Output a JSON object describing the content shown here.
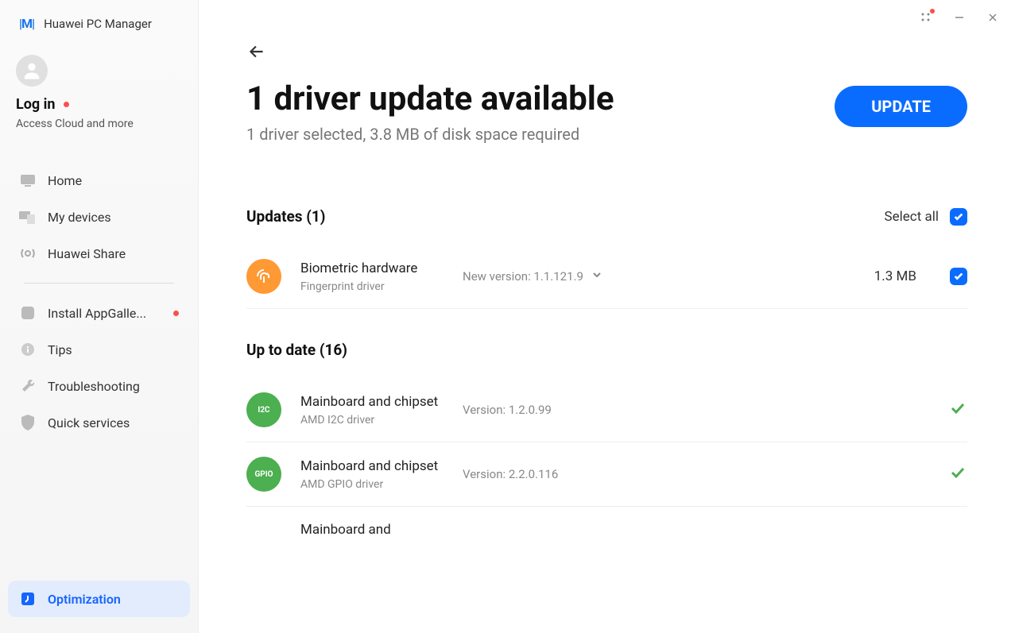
{
  "app": {
    "title": "Huawei PC Manager",
    "login_label": "Log in",
    "login_sub": "Access Cloud and more"
  },
  "nav": {
    "home": "Home",
    "my_devices": "My devices",
    "huawei_share": "Huawei Share",
    "install_appgallery": "Install AppGalle...",
    "tips": "Tips",
    "troubleshooting": "Troubleshooting",
    "quick_services": "Quick services",
    "optimization": "Optimization"
  },
  "page": {
    "title": "1 driver update available",
    "subtitle": "1 driver selected, 3.8 MB of disk space required",
    "update_button": "UPDATE",
    "updates_header": "Updates (1)",
    "select_all": "Select all",
    "uptodate_header": "Up to date (16)"
  },
  "updates": [
    {
      "name": "Biometric hardware",
      "sub": "Fingerprint driver",
      "version": "New version: 1.1.121.9",
      "size": "1.3 MB",
      "icon": "fingerprint"
    }
  ],
  "uptodate": [
    {
      "name": "Mainboard and chipset",
      "sub": "AMD I2C driver",
      "version": "Version: 1.2.0.99",
      "icon_text": "I2C"
    },
    {
      "name": "Mainboard and chipset",
      "sub": "AMD GPIO driver",
      "version": "Version: 2.2.0.116",
      "icon_text": "GPIO"
    },
    {
      "name": "Mainboard and",
      "sub": "",
      "version": "",
      "icon_text": ""
    }
  ]
}
